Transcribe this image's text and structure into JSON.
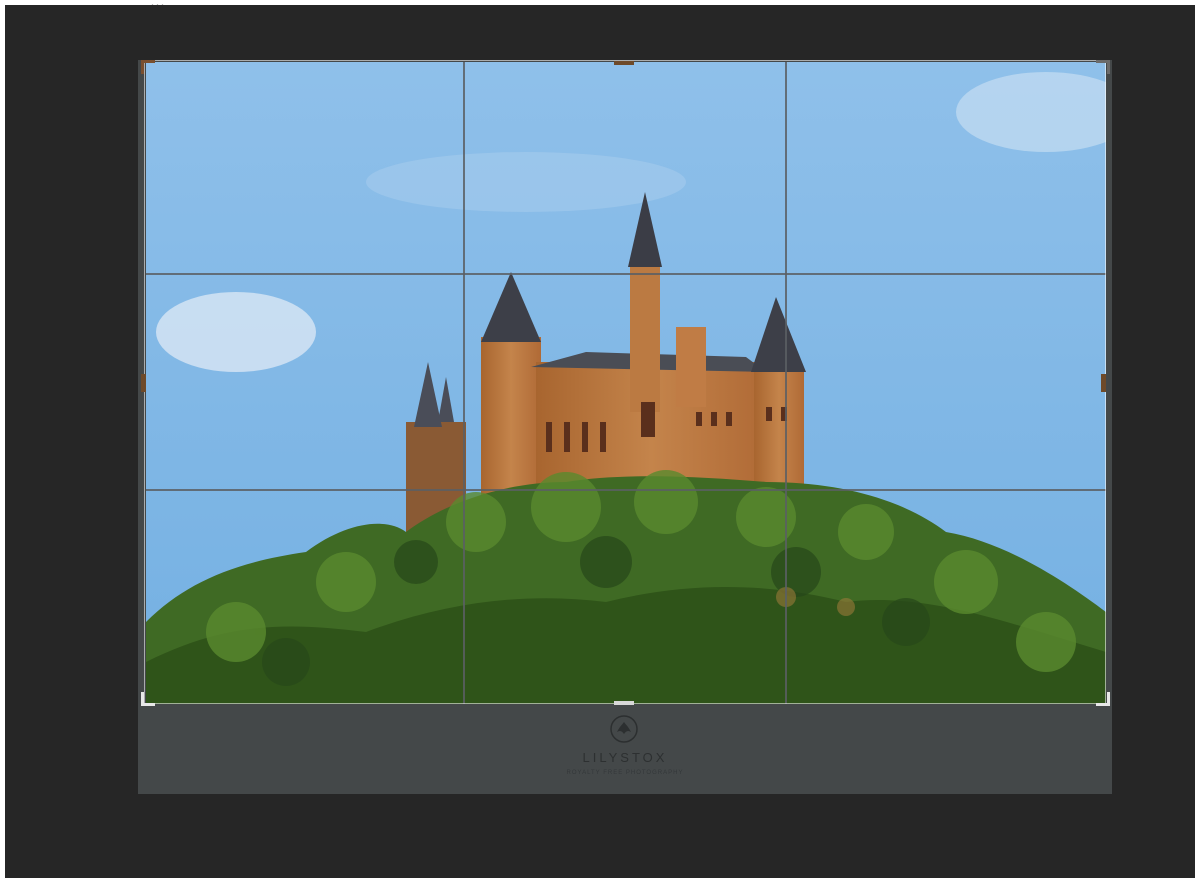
{
  "caption": "...",
  "crop": {
    "overlay": "rule-of-thirds"
  },
  "watermark": {
    "brand": "LILYSTOX",
    "tagline": "ROYALTY FREE PHOTOGRAPHY",
    "icon": "lily-logo-icon"
  },
  "colors": {
    "workspace": "#262626",
    "canvas": "#444849",
    "sky": "#7fb6e4",
    "foliage": "#3f6a24",
    "castle": "#b9753f"
  }
}
